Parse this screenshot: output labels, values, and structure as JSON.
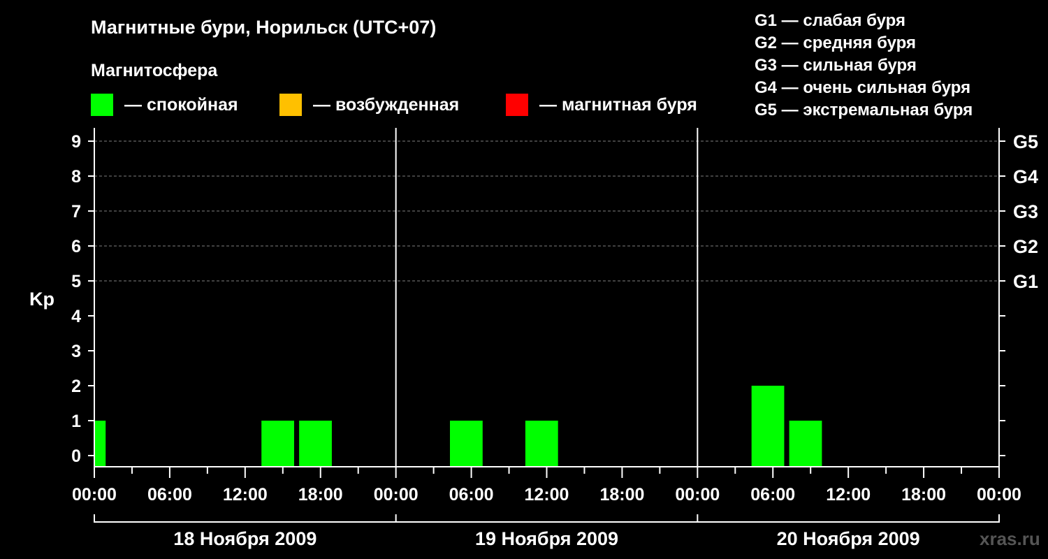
{
  "title": "Магнитные бури, Норильск (UTC+07)",
  "magnetosphere_label": "Магнитосфера",
  "legend": [
    {
      "name": "— спокойная",
      "color": "#00ff00"
    },
    {
      "name": "— возбужденная",
      "color": "#ffc000"
    },
    {
      "name": "— магнитная буря",
      "color": "#ff0000"
    }
  ],
  "g_scale": [
    "G1 — слабая буря",
    "G2 — средняя буря",
    "G3 — сильная буря",
    "G4 — очень сильная буря",
    "G5 — экстремальная буря"
  ],
  "watermark": "xras.ru",
  "chart_data": {
    "type": "bar",
    "ylabel": "Kp",
    "ylim": [
      0,
      9
    ],
    "yticks": [
      "0",
      "1",
      "2",
      "3",
      "4",
      "5",
      "6",
      "7",
      "8",
      "9"
    ],
    "right_ticks": [
      {
        "kp": 5,
        "label": "G1"
      },
      {
        "kp": 6,
        "label": "G2"
      },
      {
        "kp": 7,
        "label": "G3"
      },
      {
        "kp": 8,
        "label": "G4"
      },
      {
        "kp": 9,
        "label": "G5"
      }
    ],
    "grid": "dashed horizontal at Kp 5–9",
    "xlim_hours": [
      0,
      72
    ],
    "xtick_labels": [
      "00:00",
      "06:00",
      "12:00",
      "18:00",
      "00:00",
      "06:00",
      "12:00",
      "18:00",
      "00:00",
      "06:00",
      "12:00",
      "18:00",
      "00:00"
    ],
    "days": [
      "18 Ноября 2009",
      "19 Ноября 2009",
      "20 Ноября 2009"
    ],
    "bars": [
      {
        "start_hour": 0,
        "end_hour": 0.9,
        "kp": 1,
        "color": "#00ff00"
      },
      {
        "start_hour": 13.3,
        "end_hour": 15.9,
        "kp": 1,
        "color": "#00ff00"
      },
      {
        "start_hour": 16.3,
        "end_hour": 18.9,
        "kp": 1,
        "color": "#00ff00"
      },
      {
        "start_hour": 28.3,
        "end_hour": 30.9,
        "kp": 1,
        "color": "#00ff00"
      },
      {
        "start_hour": 34.3,
        "end_hour": 36.9,
        "kp": 1,
        "color": "#00ff00"
      },
      {
        "start_hour": 52.3,
        "end_hour": 54.9,
        "kp": 2,
        "color": "#00ff00"
      },
      {
        "start_hour": 55.3,
        "end_hour": 57.9,
        "kp": 1,
        "color": "#00ff00"
      }
    ]
  }
}
